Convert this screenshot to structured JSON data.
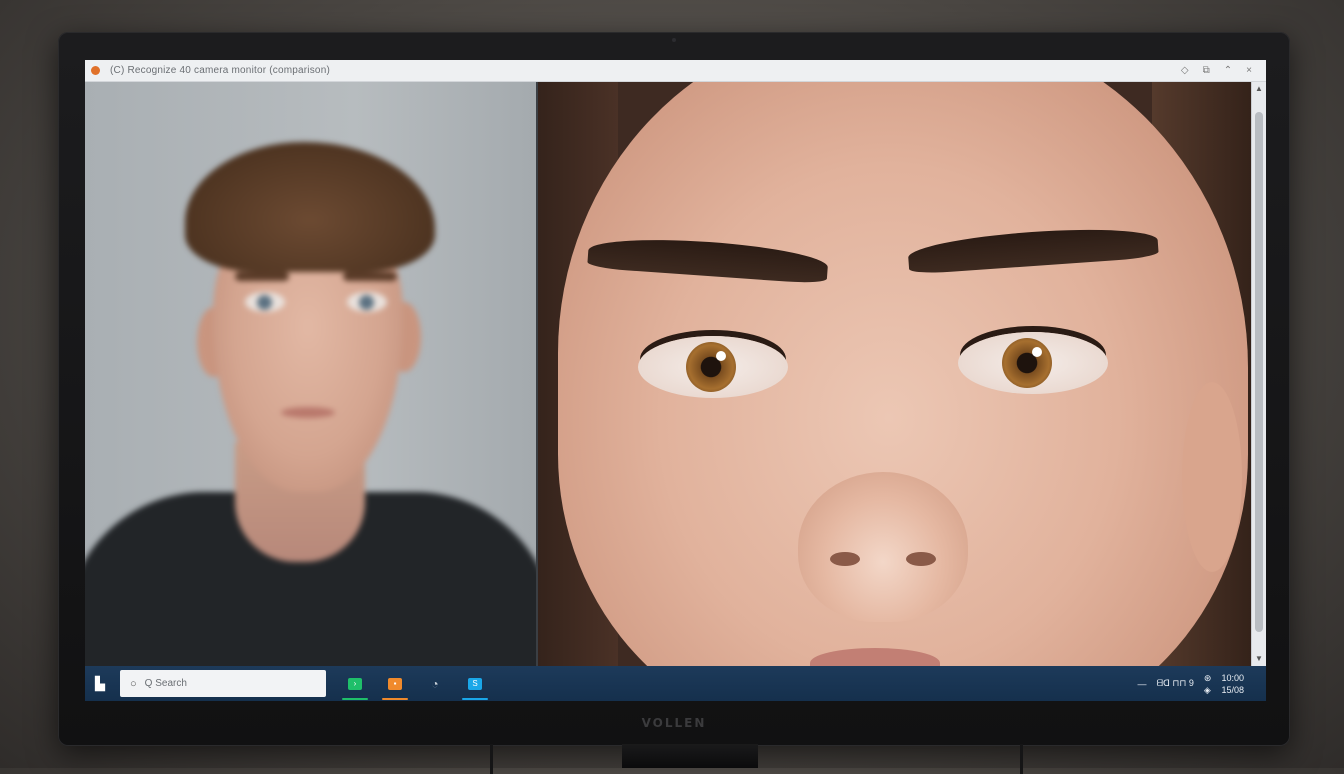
{
  "window": {
    "title": "(C) Recognize 40 camera monitor (comparison)",
    "controls": {
      "pin": "◇",
      "restore": "⧉",
      "minimize": "⌃",
      "close": "×"
    }
  },
  "monitor": {
    "brand": "VOLLEN"
  },
  "taskbar": {
    "start_glyph": "▙",
    "search_placeholder": "Q  Search",
    "apps": [
      {
        "name": "terminal",
        "glyph": "›",
        "color": "#1fbf6a"
      },
      {
        "name": "files",
        "glyph": "▪",
        "color": "#f08a2c"
      },
      {
        "name": "browser",
        "glyph": "◔",
        "color": "#c9d1d9"
      },
      {
        "name": "store",
        "glyph": "S",
        "color": "#1aa7e8"
      }
    ],
    "tray": {
      "hidden_icons": "—",
      "indicators": "ᗺᗡ ⊓⊓ 9",
      "wifi": "⊛",
      "volume": "◈"
    },
    "clock": {
      "time": "10:00",
      "date": "15/08"
    }
  },
  "colors": {
    "taskbar": "#1d3a5a",
    "titlebar": "#eef0f2",
    "accent_orange": "#e0712a"
  }
}
